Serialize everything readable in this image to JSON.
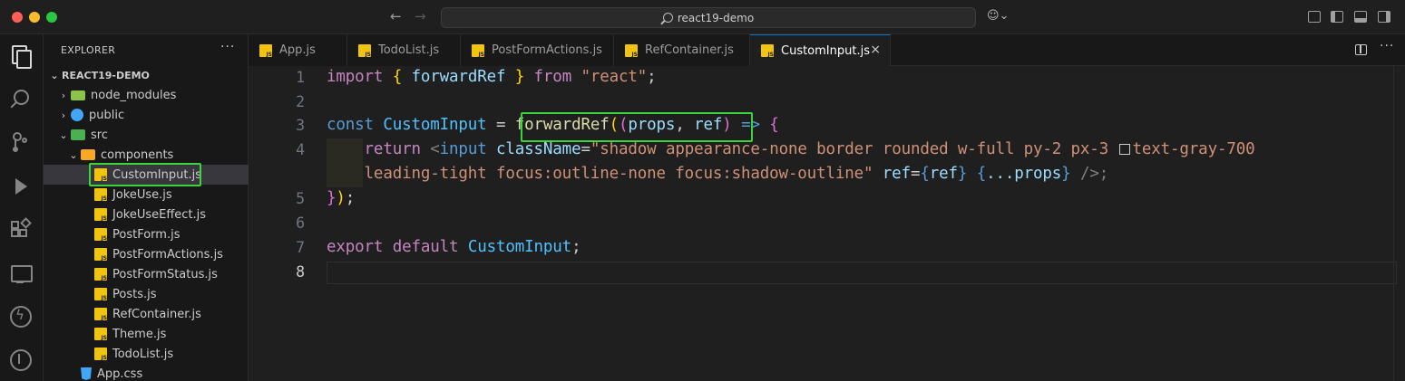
{
  "window": {
    "search_text": "react19-demo"
  },
  "sidebar": {
    "title": "EXPLORER",
    "more": "···",
    "tree": [
      {
        "label": "REACT19-DEMO",
        "chev": "⌄",
        "icon": "none",
        "depth": 0
      },
      {
        "label": "node_modules",
        "chev": "›",
        "icon": "folder-node-icon",
        "depth": 1
      },
      {
        "label": "public",
        "chev": "›",
        "icon": "folder-public-icon",
        "depth": 1
      },
      {
        "label": "src",
        "chev": "⌄",
        "icon": "folder-src-icon",
        "depth": 1
      },
      {
        "label": "components",
        "chev": "⌄",
        "icon": "folder-components-icon",
        "depth": 2
      },
      {
        "label": "CustomInput.js",
        "chev": "",
        "icon": "js-file-icon",
        "depth": 3,
        "selected": true
      },
      {
        "label": "JokeUse.js",
        "chev": "",
        "icon": "js-file-icon",
        "depth": 3
      },
      {
        "label": "JokeUseEffect.js",
        "chev": "",
        "icon": "js-file-icon",
        "depth": 3
      },
      {
        "label": "PostForm.js",
        "chev": "",
        "icon": "js-file-icon",
        "depth": 3
      },
      {
        "label": "PostFormActions.js",
        "chev": "",
        "icon": "js-file-icon",
        "depth": 3
      },
      {
        "label": "PostFormStatus.js",
        "chev": "",
        "icon": "js-file-icon",
        "depth": 3
      },
      {
        "label": "Posts.js",
        "chev": "",
        "icon": "js-file-icon",
        "depth": 3
      },
      {
        "label": "RefContainer.js",
        "chev": "",
        "icon": "js-file-icon",
        "depth": 3
      },
      {
        "label": "Theme.js",
        "chev": "",
        "icon": "js-file-icon",
        "depth": 3
      },
      {
        "label": "TodoList.js",
        "chev": "",
        "icon": "js-file-icon",
        "depth": 3
      },
      {
        "label": "App.css",
        "chev": "",
        "icon": "css-file-icon",
        "depth": 2
      }
    ]
  },
  "tabs": [
    {
      "label": "App.js",
      "active": false
    },
    {
      "label": "TodoList.js",
      "active": false
    },
    {
      "label": "PostFormActions.js",
      "active": false
    },
    {
      "label": "RefContainer.js",
      "active": false
    },
    {
      "label": "CustomInput.js",
      "active": true
    }
  ],
  "tab_close": "×",
  "tabs_more": "···",
  "editor": {
    "line_numbers": [
      "1",
      "2",
      "3",
      "4",
      "5",
      "6",
      "7",
      "8"
    ],
    "active_line": "8",
    "line1": {
      "kw_import": "import",
      "brace_open": "{",
      "name": "forwardRef",
      "brace_close": "}",
      "kw_from": "from",
      "str": "\"react\"",
      "semi": ";"
    },
    "line3": {
      "kw_const": "const",
      "name": "CustomInput",
      "eq": "=",
      "fn": "forwardRef",
      "paren_outer": "(",
      "paren_inner": "(",
      "p1": "props",
      "comma": ",",
      "p2": "ref",
      "paren_inner_close": ")",
      "arrow": "=>",
      "brace": "{"
    },
    "line4": {
      "kw_return": "return",
      "lt": "<",
      "tag": "input",
      "attr": "className",
      "eq": "=",
      "str": "\"shadow appearance-none border rounded w-full py-2 px-3",
      "str_rest": "text-gray-700"
    },
    "line4b": {
      "str": "leading-tight focus:outline-none focus:shadow-outline\"",
      "attr": "ref",
      "eq": "=",
      "b_open": "{",
      "ref": "ref",
      "b_close": "}",
      "sp_open": "{",
      "spread": "...props",
      "sp_close": "}",
      "end": "/>;"
    },
    "line5": {
      "brace": "}",
      "paren": ")",
      "semi": ";"
    },
    "line7": {
      "kw_export": "export",
      "kw_default": "default",
      "name": "CustomInput",
      "semi": ";"
    }
  }
}
